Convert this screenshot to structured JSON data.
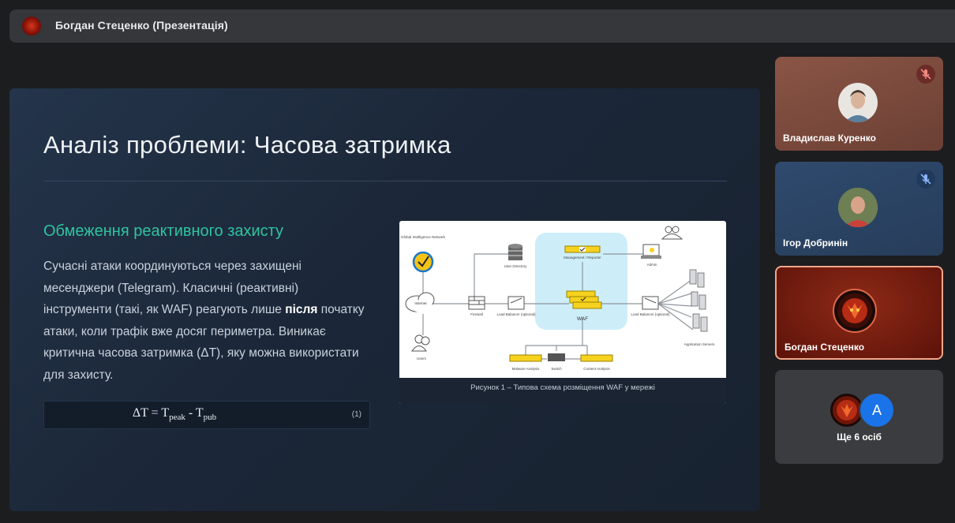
{
  "presenter_bar": {
    "title": "Богдан Стеценко (Презентація)"
  },
  "slide": {
    "title": "Аналіз проблеми: Часова затримка",
    "subtitle": "Обмеження реактивного захисту",
    "body_part1": "Сучасні атаки координуються через захищені месенджери (Telegram). Класичні (реактивні) інструменти (такі, як WAF) реагують лише ",
    "body_bold": "після",
    "body_part2": " початку атаки, коли трафік вже досяг периметра. Виникає критична часова затримка (ΔT), яку можна використати для захисту.",
    "formula": {
      "lhs": "ΔT = T",
      "sub1": "peak",
      "mid": " - T",
      "sub2": "pub",
      "number": "(1)"
    },
    "figure_caption": "Рисунок 1 – Типова схема розміщення WAF у мережі",
    "diagram_labels": {
      "global_intel": "Global Intelligence Network",
      "internet": "Internet",
      "users": "Users",
      "firewall": "Firewall",
      "user_directory": "User Directory",
      "lb_left": "Load Balancer (optional)",
      "management": "Management / Reporter",
      "waf": "WAF",
      "admin": "Admin",
      "lb_right": "Load Balancer (optional)",
      "app_servers": "Application Servers",
      "malware": "Malware Analysis",
      "switch": "Switch",
      "content": "Content Analysis"
    }
  },
  "participants": [
    {
      "name": "Владислав Куренко",
      "muted": true,
      "bg": "#7b4a3e"
    },
    {
      "name": "Ігор Добринін",
      "muted": true,
      "bg": "#2c4364"
    },
    {
      "name": "Богдан Стеценко",
      "muted": false,
      "bg": "#7a1d12"
    }
  ],
  "more_tile": {
    "label": "Ще 6 осіб",
    "avatar_letter": "A",
    "accent": "#1a73e8"
  }
}
